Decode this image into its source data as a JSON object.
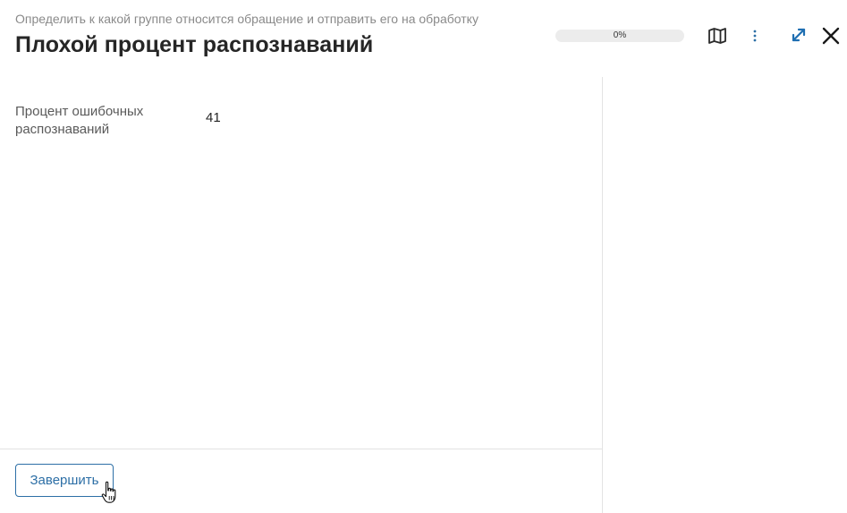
{
  "header": {
    "subtitle": "Определить к какой группе относится обращение и отправить его на обработку",
    "title": "Плохой процент распознаваний",
    "progress": {
      "value": 0,
      "label": "0%"
    },
    "icons": {
      "map": "map-icon",
      "more": "more-vertical-icon",
      "expand": "expand-icon",
      "close": "close-icon"
    }
  },
  "form": {
    "fields": [
      {
        "label": "Процент ошибочных распознаваний",
        "value": "41"
      }
    ]
  },
  "footer": {
    "finish_label": "Завершить"
  },
  "colors": {
    "accent": "#2d6fa6",
    "expand_icon": "#1f6fb2",
    "subtitle_text": "#8a8a8a",
    "divider": "#e3e3e3"
  }
}
